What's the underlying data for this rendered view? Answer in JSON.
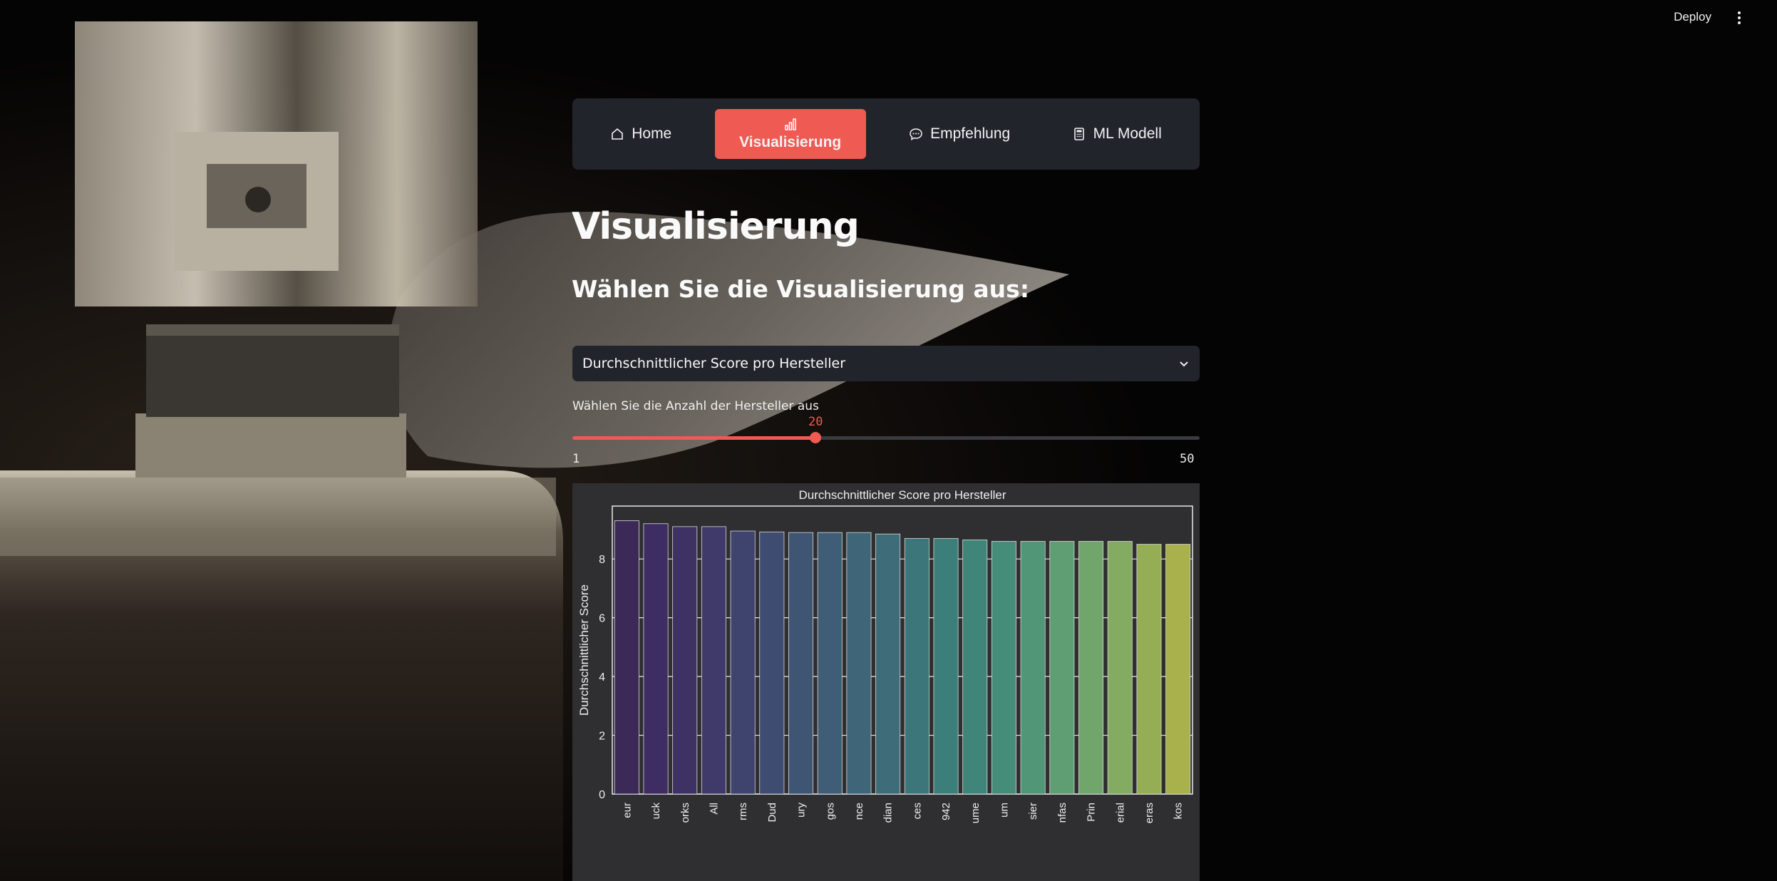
{
  "header": {
    "deploy_label": "Deploy"
  },
  "nav": {
    "items": [
      {
        "label": "Home",
        "icon": "home-icon"
      },
      {
        "label": "Visualisierung",
        "icon": "bar-chart-icon",
        "active": true
      },
      {
        "label": "Empfehlung",
        "icon": "chat-icon"
      },
      {
        "label": "ML Modell",
        "icon": "calculator-icon"
      }
    ]
  },
  "page": {
    "title": "Visualisierung",
    "subtitle": "Wählen Sie die Visualisierung aus:"
  },
  "select": {
    "value": "Durchschnittlicher Score pro Hersteller"
  },
  "slider": {
    "label": "Wählen Sie die Anzahl der Hersteller aus",
    "value": 20,
    "min": 1,
    "max": 50,
    "value_text": "20",
    "min_text": "1",
    "max_text": "50"
  },
  "colors": {
    "accent": "#ef5a52",
    "panel": "#22242c"
  },
  "chart_data": {
    "type": "bar",
    "title": "Durchschnittlicher Score pro Hersteller",
    "ylabel": "Durchschnittlicher Score",
    "xlabel": "",
    "categories": [
      "eur",
      "uck",
      "orks",
      "All",
      "rms",
      "Dud",
      "ury",
      "gos",
      "nce",
      "dian",
      "ces",
      "942",
      "ume",
      "um",
      "sier",
      "nfas",
      "Prin",
      "erial",
      "eras",
      "kos"
    ],
    "values": [
      9.3,
      9.2,
      9.1,
      9.1,
      8.95,
      8.92,
      8.9,
      8.9,
      8.9,
      8.85,
      8.7,
      8.7,
      8.65,
      8.6,
      8.6,
      8.6,
      8.6,
      8.6,
      8.5,
      8.5
    ],
    "ylim": [
      0,
      9.8
    ],
    "yticks": [
      0,
      2,
      4,
      6,
      8
    ],
    "grid": true,
    "palette": [
      "#3b2a58",
      "#3e2d62",
      "#3e3264",
      "#3f3a6a",
      "#3f446e",
      "#3f4c72",
      "#3f5574",
      "#3f5d77",
      "#3f6678",
      "#3e6d79",
      "#3c767a",
      "#3b7e7a",
      "#3f857a",
      "#468d79",
      "#519677",
      "#5f9e72",
      "#70a56c",
      "#83ab62",
      "#95ae55",
      "#a8b14c"
    ]
  }
}
